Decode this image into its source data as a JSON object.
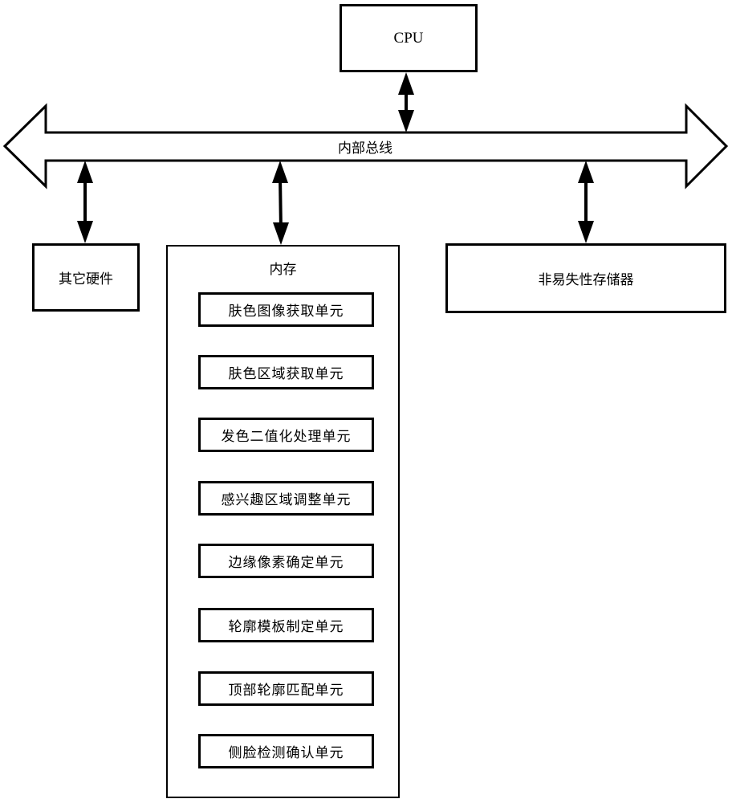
{
  "diagram": {
    "cpu": {
      "label": "CPU"
    },
    "bus": {
      "label": "内部总线"
    },
    "other_hardware": {
      "label": "其它硬件"
    },
    "nonvolatile_storage": {
      "label": "非易失性存储器"
    },
    "memory": {
      "label": "内存",
      "units": [
        {
          "label": "肤色图像获取单元"
        },
        {
          "label": "肤色区域获取单元"
        },
        {
          "label": "发色二值化处理单元"
        },
        {
          "label": "感兴趣区域调整单元"
        },
        {
          "label": "边缘像素确定单元"
        },
        {
          "label": "轮廓模板制定单元"
        },
        {
          "label": "顶部轮廓匹配单元"
        },
        {
          "label": "侧脸检测确认单元"
        }
      ]
    },
    "connections": [
      {
        "from": "CPU",
        "to": "内部总线",
        "type": "bidirectional"
      },
      {
        "from": "内部总线",
        "to": "其它硬件",
        "type": "bidirectional"
      },
      {
        "from": "内部总线",
        "to": "内存",
        "type": "bidirectional"
      },
      {
        "from": "内部总线",
        "to": "非易失性存储器",
        "type": "bidirectional"
      }
    ]
  }
}
